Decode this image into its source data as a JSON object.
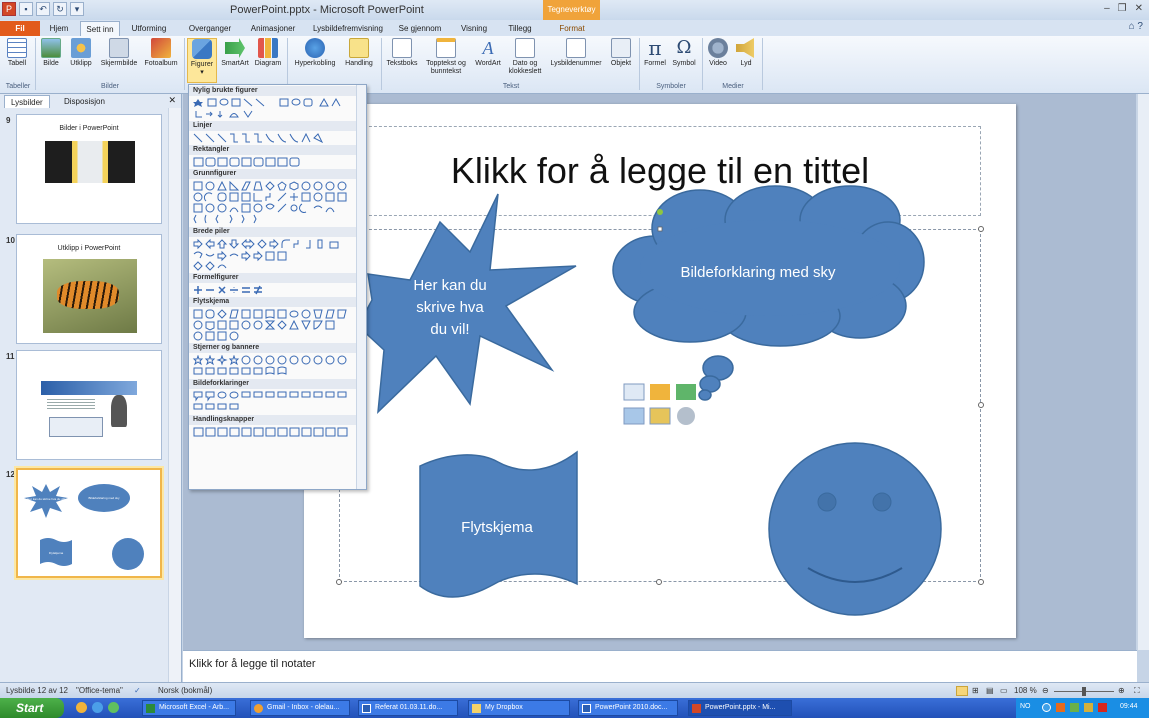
{
  "window": {
    "title": "PowerPoint.pptx  -  Microsoft PowerPoint",
    "context_tab": "Tegneverktøy"
  },
  "ribbon_tabs": [
    "Fil",
    "Hjem",
    "Sett inn",
    "Utforming",
    "Overganger",
    "Animasjoner",
    "Lysbildefremvisning",
    "Se gjennom",
    "Visning",
    "Tillegg",
    "Format"
  ],
  "ribbon": {
    "buttons": [
      {
        "label": "Tabell",
        "icon": "table-icon"
      },
      {
        "label": "Bilde",
        "icon": "picture-icon"
      },
      {
        "label": "Utklipp",
        "icon": "clipart-icon"
      },
      {
        "label": "Skjermbilde",
        "icon": "screenshot-icon"
      },
      {
        "label": "Fotoalbum",
        "icon": "photo-album-icon"
      },
      {
        "label": "Figurer",
        "icon": "shapes-icon"
      },
      {
        "label": "SmartArt",
        "icon": "smartart-icon"
      },
      {
        "label": "Diagram",
        "icon": "chart-icon"
      },
      {
        "label": "Hyperkobling",
        "icon": "hyperlink-icon"
      },
      {
        "label": "Handling",
        "icon": "action-icon"
      },
      {
        "label": "Tekstboks",
        "icon": "textbox-icon"
      },
      {
        "label": "Topptekst og bunntekst",
        "icon": "header-footer-icon"
      },
      {
        "label": "WordArt",
        "icon": "wordart-icon"
      },
      {
        "label": "Dato og klokkeslett",
        "icon": "date-time-icon"
      },
      {
        "label": "Lysbildenummer",
        "icon": "slide-number-icon"
      },
      {
        "label": "Objekt",
        "icon": "object-icon"
      },
      {
        "label": "Formel",
        "icon": "formula-icon"
      },
      {
        "label": "Symbol",
        "icon": "symbol-icon"
      },
      {
        "label": "Video",
        "icon": "video-icon"
      },
      {
        "label": "Lyd",
        "icon": "audio-icon"
      }
    ],
    "groups": [
      "Tabeller",
      "Bilder",
      "Tekst",
      "Symboler",
      "Medier"
    ]
  },
  "left_pane": {
    "tabs": [
      "Lysbilder",
      "Disposisjon"
    ],
    "slides": [
      {
        "number": "9",
        "caption": "Bilder i PowerPoint"
      },
      {
        "number": "10",
        "caption": "Utklipp i PowerPoint"
      },
      {
        "number": "11",
        "caption": ""
      },
      {
        "number": "12",
        "caption": ""
      }
    ],
    "thumb12": {
      "burst": "Her kan du skrive hva du vil!",
      "cloud": "Bildeforklaring med sky",
      "flow": "Flytskjema"
    }
  },
  "gallery": {
    "sections": [
      "Nylig brukte figurer",
      "Linjer",
      "Rektangler",
      "Grunnfigurer",
      "Brede piler",
      "Formelfigurer",
      "Flytskjema",
      "Stjerner og bannere",
      "Bildeforklaringer",
      "Handlingsknapper"
    ]
  },
  "slide": {
    "title": "Klikk for å legge til en tittel",
    "burst_text": "Her kan du skrive hva du vil!",
    "cloud_text": "Bildeforklaring med sky",
    "flow_text": "Flytskjema"
  },
  "notes": {
    "placeholder": "Klikk for å legge til notater"
  },
  "status": {
    "slide": "Lysbilde 12 av 12",
    "theme": "\"Office-tema\"",
    "language": "Norsk (bokmål)",
    "zoom": "108 %"
  },
  "taskbar": {
    "start": "Start",
    "tasks": [
      "Microsoft Excel - Arb...",
      "Gmail - Inbox - olelau...",
      "Referat 01.03.11.do...",
      "My Dropbox",
      "PowerPoint 2010.doc...",
      "PowerPoint.pptx - Mi..."
    ],
    "lang": "NO",
    "time": "09:44"
  },
  "colors": {
    "shape_fill": "#4f81bd",
    "shape_stroke": "#3a6a9e",
    "file_tab": "#e25b1c",
    "context_tab": "#f0a33a"
  }
}
